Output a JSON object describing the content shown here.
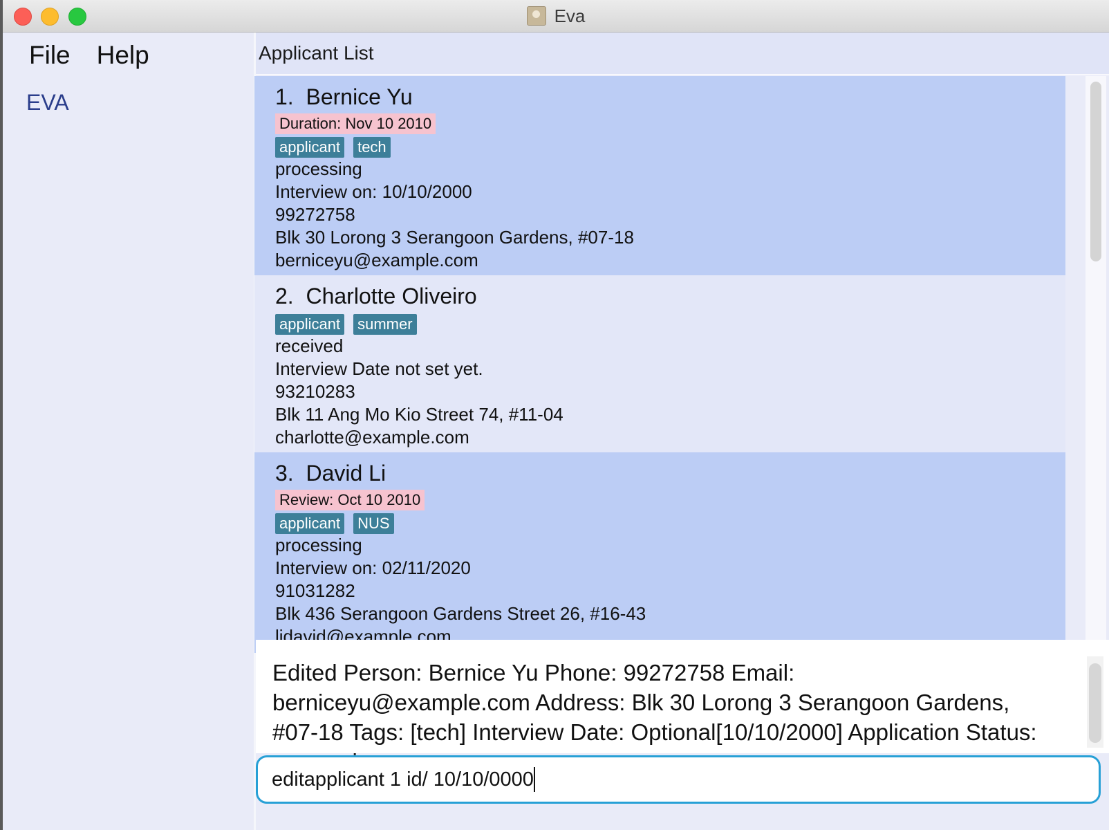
{
  "window": {
    "title": "Eva"
  },
  "menu": {
    "file": "File",
    "help": "Help"
  },
  "sidebar": {
    "brand": "EVA"
  },
  "list": {
    "header": "Applicant List",
    "applicants": [
      {
        "index": "1.",
        "name": "Bernice Yu",
        "highlight": "Duration: Nov 10 2010",
        "tags": [
          "applicant",
          "tech"
        ],
        "status": "processing",
        "interview": "Interview on: 10/10/2000",
        "phone": "99272758",
        "address": "Blk 30 Lorong 3 Serangoon Gardens, #07-18",
        "email": "berniceyu@example.com"
      },
      {
        "index": "2.",
        "name": "Charlotte Oliveiro",
        "highlight": "",
        "tags": [
          "applicant",
          "summer"
        ],
        "status": "received",
        "interview": "Interview Date not set yet.",
        "phone": "93210283",
        "address": "Blk 11 Ang Mo Kio Street 74, #11-04",
        "email": "charlotte@example.com"
      },
      {
        "index": "3.",
        "name": "David Li",
        "highlight": "Review: Oct 10 2010",
        "tags": [
          "applicant",
          "NUS"
        ],
        "status": "processing",
        "interview": "Interview on: 02/11/2020",
        "phone": "91031282",
        "address": "Blk 436 Serangoon Gardens Street 26, #16-43",
        "email": "lidavid@example.com"
      }
    ]
  },
  "result": {
    "text": "Edited Person: Bernice Yu Phone: 99272758 Email: berniceyu@example.com Address: Blk 30 Lorong 3 Serangoon Gardens, #07-18 Tags: [tech] Interview Date: Optional[10/10/2000] Application Status: processing"
  },
  "command": {
    "value": "editapplicant 1 id/ 10/10/0000"
  },
  "colors": {
    "card_selected": "#bccdf5",
    "card_plain": "#e3e7f8",
    "tag": "#3d7f99",
    "highlight_tag": "#f6c3cf",
    "focus_border": "#27a0d6"
  }
}
